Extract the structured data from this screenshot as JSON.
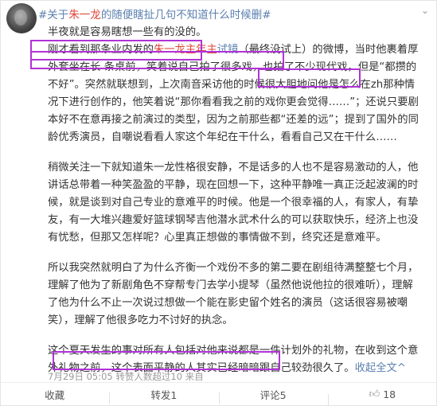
{
  "post": {
    "headline_prefix": "#关于",
    "headline_name": "朱一龙",
    "headline_suffix": "的随便瞎扯几句不知道什么时候删#",
    "line0": "半夜就是容易瞎想一些有的没的。",
    "line1_a": "刚才看到那条业内发的",
    "line1_topic": "朱一龙主年主",
    "line1_link": "试镜",
    "line1_b": "（最终没试上）的微博，当时他裹着厚外套坐在长",
    "para1_rest_a": "条桌前，笑着说自己拍了很多戏，也拍了不少现代戏，",
    "para1_quote": "但是“都攒的不好”",
    "para1_rest_b": "。突然就联想到，上次南音采访他的时候很大胆地问他是怎么在zh那种情况下进行创作的，他笑着说“那你看看我之前的戏你更会觉得……”；还说只要剧本好不在意再接之前演过的类型，因为之前那些都“还差的远”；提到了国外的同龄优秀演员，自嘲说看看人家这个年纪在干什么，看看自己又在干什么……",
    "para2": "稍微关注一下就知道朱一龙性格很安静，不是话多的人也不是容易激动的人，他讲话总带着一种笑盈盈的平静，现在回想一下，这种平静唯一真正泛起波澜的时候，就是谈到对自己专业的意难平的时候。他是一个很幸福的人，有家人，有挚友，有一大堆兴趣爱好篮球钢琴吉他潜水武术什么的可以获取快乐，经济上也没有忧愁，但那又怎样呢？心里真正想做的事情做不到，终究还是意难平。",
    "para3": "所以我突然就明白了为什么齐衡一个戏份不多的第二要在剧组待满整整七个月，理解了他为了新剧角色不穿帮专门去学小提琴（虽然他说他拉的很难听），理解了他为什么不止一次说过想做一个能在影史留个姓名的演员（这话很容易被嘲笑），理解了他很多吃力不讨好的执念。",
    "para4_a": "这个夏天发生的事对所有人包括对他来说都是一件计划外的礼物，在收到这个意外礼物之前，",
    "para4_b": "这个表面平静的人其实已经暗暗跟自己较劲很久了。",
    "expand": "收起全文",
    "expand_arrow": "^"
  },
  "meta": {
    "timestamp": "7月29日 05:05",
    "likes_note": "转赞人数超过10 来自"
  },
  "actions": {
    "favorite": "收藏",
    "repost": "转发1",
    "comment": "评论5",
    "like_count": "18"
  }
}
